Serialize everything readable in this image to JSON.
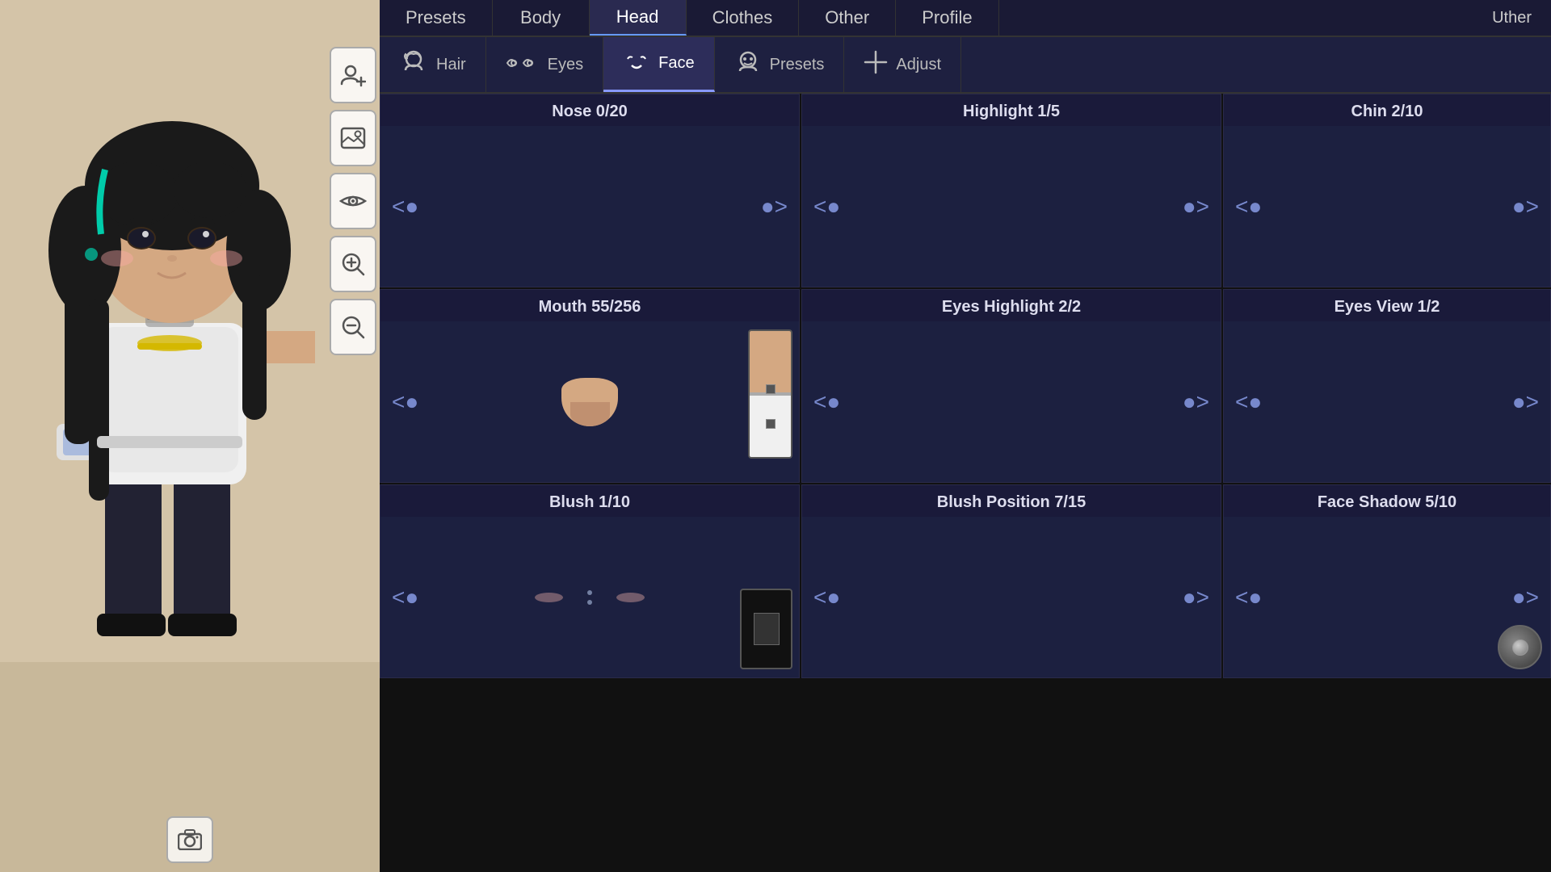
{
  "topNav": {
    "tabs": [
      {
        "id": "presets",
        "label": "Presets",
        "active": false
      },
      {
        "id": "body",
        "label": "Body",
        "active": false
      },
      {
        "id": "head",
        "label": "Head",
        "active": true
      },
      {
        "id": "clothes",
        "label": "Clothes",
        "active": false
      },
      {
        "id": "other",
        "label": "Other",
        "active": false
      },
      {
        "id": "profile",
        "label": "Profile",
        "active": false
      }
    ],
    "userName": "Uther"
  },
  "subTabs": [
    {
      "id": "hair",
      "label": "Hair",
      "icon": "👤",
      "active": false
    },
    {
      "id": "eyes",
      "label": "Eyes",
      "icon": "👁",
      "active": false
    },
    {
      "id": "face",
      "label": "Face",
      "icon": "😶",
      "active": true
    },
    {
      "id": "presets",
      "label": "Presets",
      "icon": "🧑",
      "active": false
    },
    {
      "id": "adjust",
      "label": "Adjust",
      "icon": "✛",
      "active": false
    }
  ],
  "features": [
    {
      "id": "nose",
      "title": "Nose 0/20",
      "current": 0,
      "max": 20,
      "hasColorSwatch": false,
      "preview": "empty"
    },
    {
      "id": "highlight",
      "title": "Highlight 1/5",
      "current": 1,
      "max": 5,
      "hasColorSwatch": false,
      "preview": "empty"
    },
    {
      "id": "chin",
      "title": "Chin 2/10",
      "current": 2,
      "max": 10,
      "hasColorSwatch": false,
      "preview": "empty"
    },
    {
      "id": "mouth",
      "title": "Mouth 55/256",
      "current": 55,
      "max": 256,
      "hasColorSwatch": true,
      "preview": "mouth"
    },
    {
      "id": "eyesHighlight",
      "title": "Eyes Highlight 2/2",
      "current": 2,
      "max": 2,
      "hasColorSwatch": false,
      "preview": "empty"
    },
    {
      "id": "eyesView",
      "title": "Eyes View 1/2",
      "current": 1,
      "max": 2,
      "hasColorSwatch": false,
      "preview": "empty"
    },
    {
      "id": "blush",
      "title": "Blush 1/10",
      "current": 1,
      "max": 10,
      "hasColorSwatch": true,
      "preview": "blush"
    },
    {
      "id": "blushPosition",
      "title": "Blush Position 7/15",
      "current": 7,
      "max": 15,
      "hasColorSwatch": false,
      "preview": "empty"
    },
    {
      "id": "faceShadow",
      "title": "Face Shadow 5/10",
      "current": 5,
      "max": 10,
      "hasColorSwatch": false,
      "preview": "empty"
    }
  ],
  "sidebarButtons": [
    {
      "id": "add-character",
      "icon": "👤+",
      "symbol": "➕"
    },
    {
      "id": "background",
      "icon": "🖼",
      "symbol": "🖼"
    },
    {
      "id": "eye-toggle",
      "icon": "👁",
      "symbol": "👁"
    },
    {
      "id": "zoom-in",
      "icon": "🔍+",
      "symbol": "⊕"
    },
    {
      "id": "zoom-out",
      "icon": "🔍-",
      "symbol": "⊖"
    }
  ],
  "backLabel": "◀",
  "dotsLabel": "· · ·"
}
